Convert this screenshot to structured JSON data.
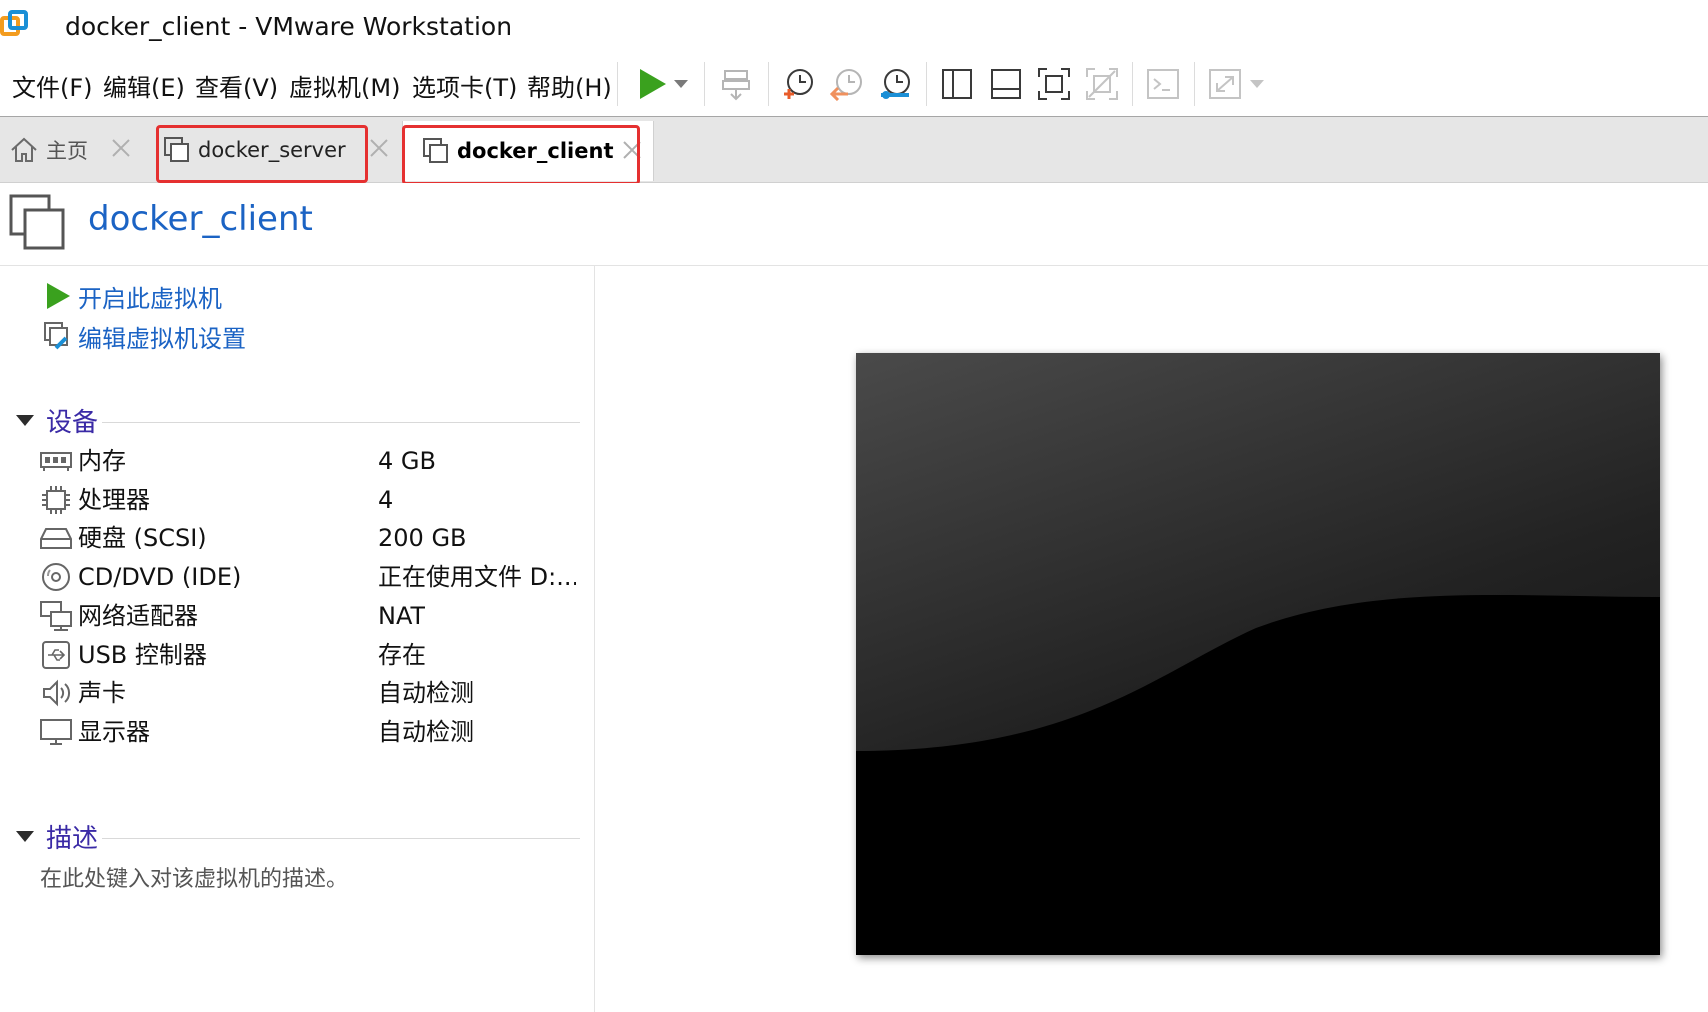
{
  "window": {
    "title": "docker_client - VMware Workstation"
  },
  "menu": [
    "文件(F)",
    "编辑(E)",
    "查看(V)",
    "虚拟机(M)",
    "选项卡(T)",
    "帮助(H)"
  ],
  "toolbar": {
    "icons": [
      "play-icon",
      "dropdown-arrow-icon",
      "send-keys-icon",
      "snapshot-take-icon",
      "snapshot-revert-icon",
      "snapshot-manager-icon",
      "library-view-icon",
      "thumbnail-bar-icon",
      "full-screen-icon",
      "unity-icon",
      "console-icon",
      "stretch-icon",
      "stretch-dropdown-icon"
    ]
  },
  "tabs": [
    {
      "label": "主页",
      "icon": "home-icon",
      "active": false
    },
    {
      "label": "docker_server",
      "icon": "vm-icon",
      "active": false
    },
    {
      "label": "docker_client",
      "icon": "vm-icon",
      "active": true
    }
  ],
  "vm": {
    "title": "docker_client",
    "actions": [
      {
        "label": "开启此虚拟机",
        "icon": "power-on-icon"
      },
      {
        "label": "编辑虚拟机设置",
        "icon": "edit-settings-icon"
      }
    ]
  },
  "devices": {
    "section_title": "设备",
    "items": [
      {
        "name": "内存",
        "value": "4 GB",
        "icon": "memory-icon"
      },
      {
        "name": "处理器",
        "value": "4",
        "icon": "cpu-icon"
      },
      {
        "name": "硬盘 (SCSI)",
        "value": "200 GB",
        "icon": "hard-disk-icon"
      },
      {
        "name": "CD/DVD (IDE)",
        "value": "正在使用文件 D:...",
        "icon": "cd-dvd-icon"
      },
      {
        "name": "网络适配器",
        "value": "NAT",
        "icon": "network-adapter-icon"
      },
      {
        "name": "USB 控制器",
        "value": "存在",
        "icon": "usb-icon"
      },
      {
        "name": "声卡",
        "value": "自动检测",
        "icon": "sound-icon"
      },
      {
        "name": "显示器",
        "value": "自动检测",
        "icon": "display-icon"
      }
    ]
  },
  "description": {
    "section_title": "描述",
    "placeholder": "在此处键入对该虚拟机的描述。"
  },
  "colors": {
    "link": "#1b63c4",
    "section": "#3a2aa6",
    "highlight": "#e53030",
    "play": "#3aa11e"
  }
}
